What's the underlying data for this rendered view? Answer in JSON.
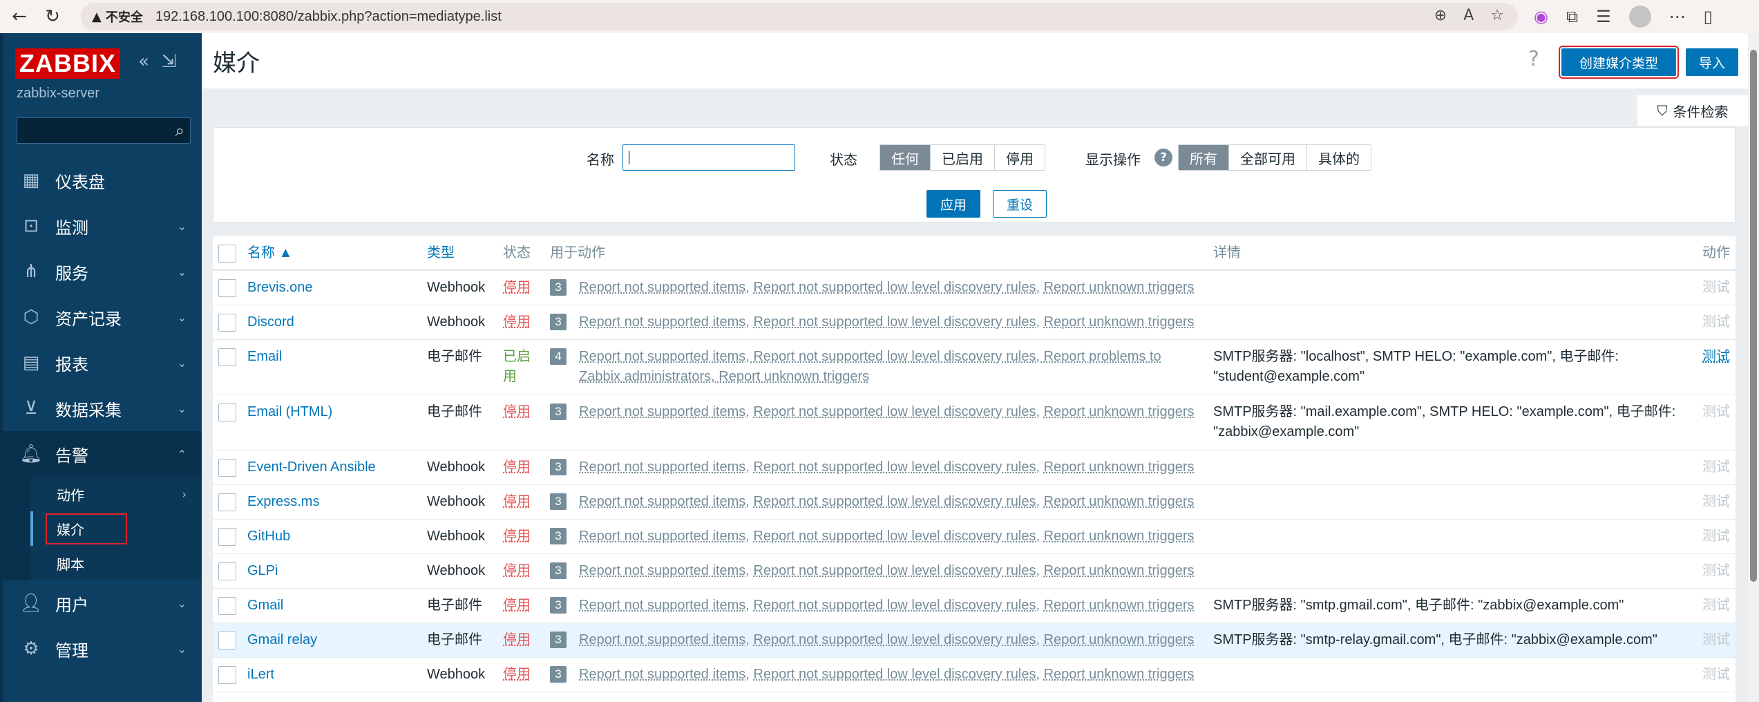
{
  "browser": {
    "insecure_label": "不安全",
    "url": "192.168.100.100:8080/zabbix.php?action=mediatype.list"
  },
  "sidebar": {
    "logo": "ZABBIX",
    "server": "zabbix-server",
    "search_placeholder": "",
    "items": [
      {
        "label": "仪表盘",
        "icon": "dashboard-icon"
      },
      {
        "label": "监测",
        "icon": "monitoring-icon"
      },
      {
        "label": "服务",
        "icon": "services-icon"
      },
      {
        "label": "资产记录",
        "icon": "inventory-icon"
      },
      {
        "label": "报表",
        "icon": "reports-icon"
      },
      {
        "label": "数据采集",
        "icon": "data-collection-icon"
      },
      {
        "label": "告警",
        "icon": "bell-icon"
      },
      {
        "label": "用户",
        "icon": "users-icon"
      },
      {
        "label": "管理",
        "icon": "gear-icon"
      }
    ],
    "alerts_sub": [
      "动作",
      "媒介",
      "脚本"
    ]
  },
  "header": {
    "title": "媒介",
    "create_label": "创建媒介类型",
    "import_label": "导入",
    "help": "?"
  },
  "filter": {
    "tab_label": "条件检索",
    "name_label": "名称",
    "name_value": "",
    "status_label": "状态",
    "status_options": [
      "任何",
      "已启用",
      "停用"
    ],
    "status_selected": "任何",
    "show_label": "显示操作",
    "show_options": [
      "所有",
      "全部可用",
      "具体的"
    ],
    "show_selected": "所有",
    "apply_label": "应用",
    "reset_label": "重设"
  },
  "table": {
    "headers": {
      "name": "名称 ▲",
      "type": "类型",
      "status": "状态",
      "used": "用于动作",
      "details": "详情",
      "action": "动作"
    },
    "rows": [
      {
        "name": "Brevis.one",
        "type": "Webhook",
        "status": "停用",
        "count": "3",
        "actions": [
          "Report not supported items",
          "Report not supported low level discovery rules",
          "Report unknown triggers"
        ],
        "details": "",
        "test": "测试"
      },
      {
        "name": "Discord",
        "type": "Webhook",
        "status": "停用",
        "count": "3",
        "actions": [
          "Report not supported items",
          "Report not supported low level discovery rules",
          "Report unknown triggers"
        ],
        "details": "",
        "test": "测试"
      },
      {
        "name": "Email",
        "type": "电子邮件",
        "status": "已启用",
        "count": "4",
        "actions_line1": "Report not supported items, Report not supported low level discovery rules, Report problems to",
        "actions_line2": "Zabbix administrators, Report unknown triggers",
        "details_line1": "SMTP服务器: \"localhost\", SMTP HELO: \"example.com\", 电子邮件:",
        "details_line2": "\"student@example.com\"",
        "test": "测试"
      },
      {
        "name": "Email (HTML)",
        "type": "电子邮件",
        "status": "停用",
        "count": "3",
        "actions": [
          "Report not supported items",
          "Report not supported low level discovery rules",
          "Report unknown triggers"
        ],
        "details_line1": "SMTP服务器: \"mail.example.com\", SMTP HELO: \"example.com\", 电子邮件:",
        "details_line2": "\"zabbix@example.com\"",
        "test": "测试"
      },
      {
        "name": "Event-Driven Ansible",
        "type": "Webhook",
        "status": "停用",
        "count": "3",
        "actions": [
          "Report not supported items",
          "Report not supported low level discovery rules",
          "Report unknown triggers"
        ],
        "details": "",
        "test": "测试"
      },
      {
        "name": "Express.ms",
        "type": "Webhook",
        "status": "停用",
        "count": "3",
        "actions": [
          "Report not supported items",
          "Report not supported low level discovery rules",
          "Report unknown triggers"
        ],
        "details": "",
        "test": "测试"
      },
      {
        "name": "GitHub",
        "type": "Webhook",
        "status": "停用",
        "count": "3",
        "actions": [
          "Report not supported items",
          "Report not supported low level discovery rules",
          "Report unknown triggers"
        ],
        "details": "",
        "test": "测试"
      },
      {
        "name": "GLPi",
        "type": "Webhook",
        "status": "停用",
        "count": "3",
        "actions": [
          "Report not supported items",
          "Report not supported low level discovery rules",
          "Report unknown triggers"
        ],
        "details": "",
        "test": "测试"
      },
      {
        "name": "Gmail",
        "type": "电子邮件",
        "status": "停用",
        "count": "3",
        "actions": [
          "Report not supported items",
          "Report not supported low level discovery rules",
          "Report unknown triggers"
        ],
        "details": "SMTP服务器: \"smtp.gmail.com\", 电子邮件: \"zabbix@example.com\"",
        "test": "测试"
      },
      {
        "name": "Gmail relay",
        "type": "电子邮件",
        "status": "停用",
        "count": "3",
        "actions": [
          "Report not supported items",
          "Report not supported low level discovery rules",
          "Report unknown triggers"
        ],
        "details": "SMTP服务器: \"smtp-relay.gmail.com\", 电子邮件: \"zabbix@example.com\"",
        "test": "测试"
      },
      {
        "name": "iLert",
        "type": "Webhook",
        "status": "停用",
        "count": "3",
        "actions": [
          "Report not supported items",
          "Report not supported low level discovery rules",
          "Report unknown triggers"
        ],
        "details": "",
        "test": "测试"
      }
    ]
  }
}
